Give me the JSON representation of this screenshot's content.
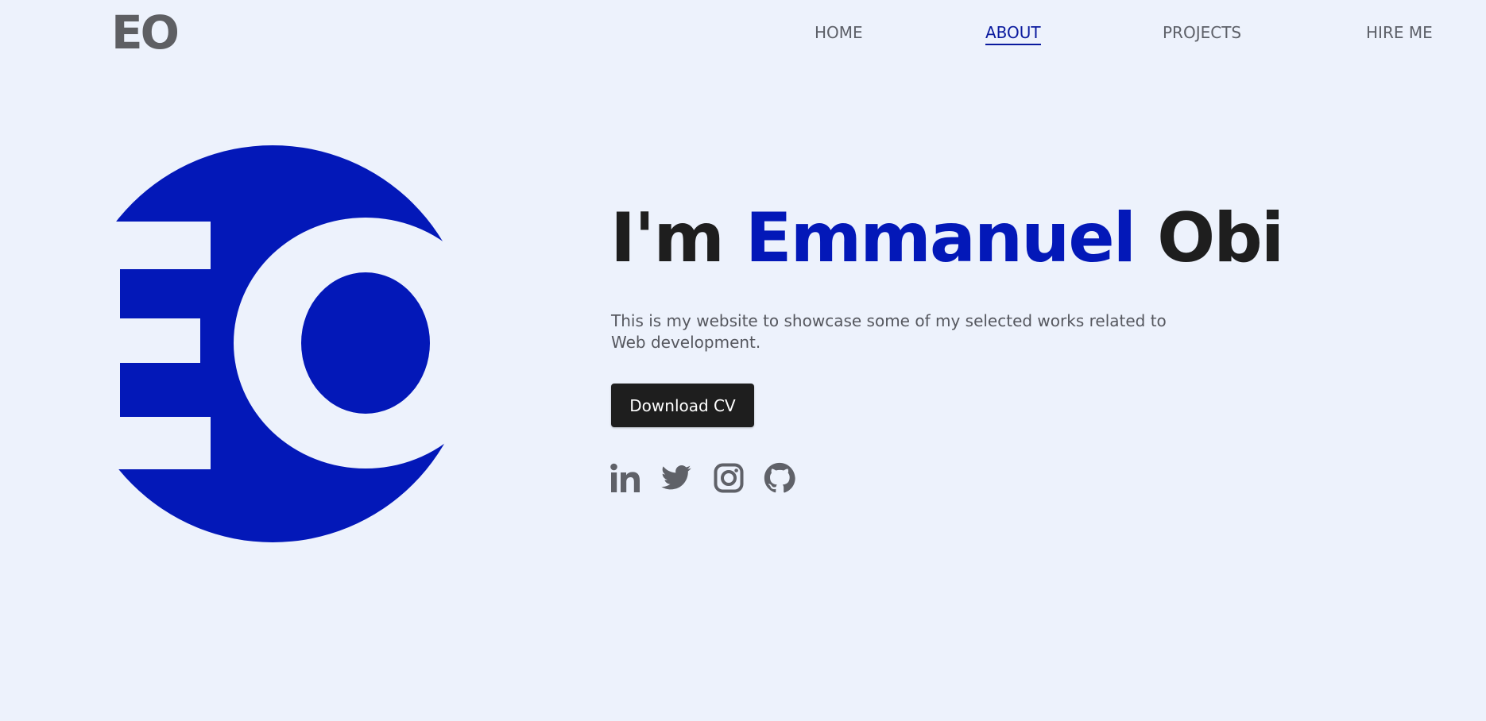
{
  "nav": {
    "logo": "EO",
    "links": [
      {
        "label": "HOME",
        "active": false
      },
      {
        "label": "ABOUT",
        "active": true
      },
      {
        "label": "PROJECTS",
        "active": false
      },
      {
        "label": "HIRE ME",
        "active": false
      }
    ]
  },
  "hero": {
    "logo_mark": "EO",
    "title_prefix": "I'm ",
    "title_highlight": "Emmanuel",
    "title_suffix": " Obi",
    "description": "This is my website to showcase some of my selected works related to Web development.",
    "cta_label": "Download CV",
    "socials": [
      {
        "icon": "linkedin-icon"
      },
      {
        "icon": "twitter-icon"
      },
      {
        "icon": "instagram-icon"
      },
      {
        "icon": "github-icon"
      }
    ]
  },
  "colors": {
    "background": "#edf2fc",
    "accent": "#0318b8",
    "text_dark": "#1e1e1e",
    "text_muted": "#5d6068"
  }
}
